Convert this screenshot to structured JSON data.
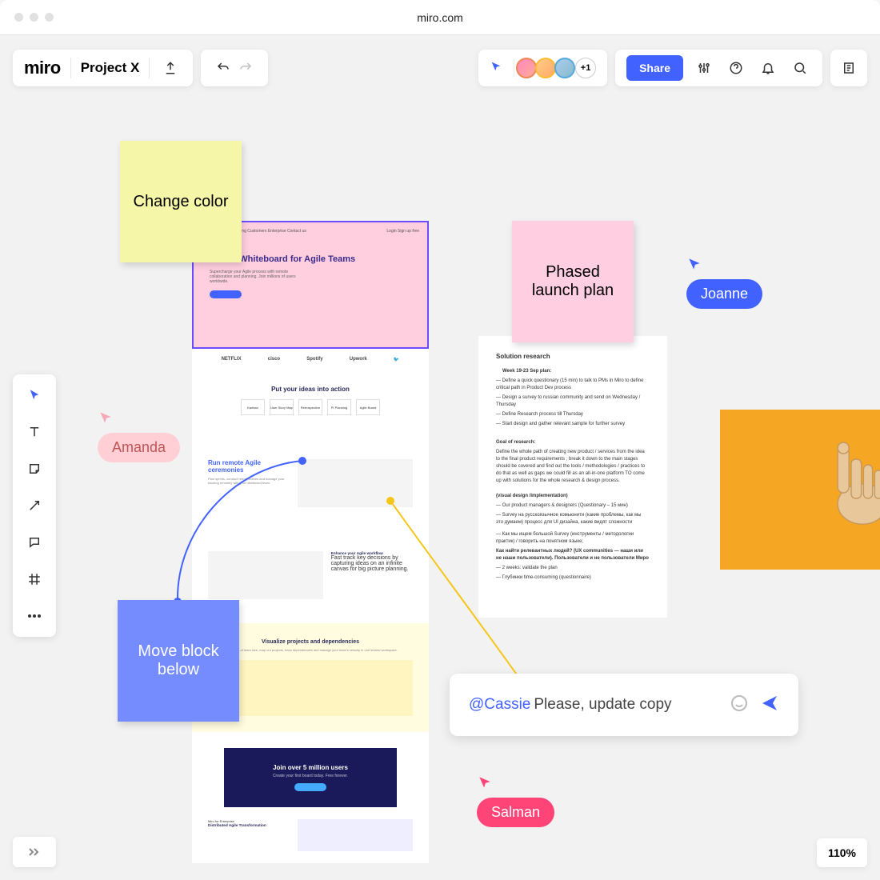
{
  "url": "miro.com",
  "header": {
    "logo": "miro",
    "project_name": "Project X",
    "more_avatars": "+1",
    "share_label": "Share"
  },
  "stickies": {
    "yellow": "Change color",
    "pink": "Phased launch plan",
    "blue": "Move block below"
  },
  "cursors": {
    "amanda": "Amanda",
    "joanne": "Joanne",
    "salman": "Salman"
  },
  "mockup": {
    "nav": "Product   Solutions   Pricing   Customers   Enterprise   Contact us",
    "nav_right": "Login   Sign up free",
    "hero_title": "Online Whiteboard for Agile Teams",
    "hero_sub": "Supercharge your Agile process with remote collaboration and planning. Join millions of users worldwide.",
    "logos": {
      "l1": "NETFLIX",
      "l2": "cisco",
      "l3": "Spotify",
      "l4": "Upwork",
      "l5": ""
    },
    "ideas_title": "Put your ideas into action",
    "cards": {
      "c1": "Kanban",
      "c2": "User Story Map",
      "c3": "Retrospective",
      "c4": "PI Planning",
      "c5": "Agile Board"
    },
    "remote_title": "Run remote Agile ceremonies",
    "remote_sub": "Plan sprints, conduct retrospectives and manage your backlog remotely with your distributed team.",
    "enhance_title": "Enhance your Agile workflow",
    "enhance_sub": "Fast track key decisions by capturing ideas on an infinite canvas for big picture planning.",
    "visualize_title": "Visualize projects and dependencies",
    "visualize_sub": "Regardless of team size, map out projects, track dependencies and manage your team's velocity in one shared workspace.",
    "join_title": "Join over 5 million users",
    "join_sub": "Create your first board today. Free forever.",
    "dist_title": "Distributed Agile Transformation",
    "dist_kicker": "Miro for Enterprise"
  },
  "document": {
    "title": "Solution research",
    "plan_title": "Week 19-23 Sep plan:",
    "p1": "— Define a quick questionary (15 min) to talk to PMs in Miro to define critical path in Product Dev process",
    "p2": "— Design a survey to russian community and send on Wednesday / Thursday",
    "p3": "— Define Research process till Thursday",
    "p4": "— Start design and gather relevant sample for further survey",
    "goal_title": "Goal of research:",
    "goal": "Define the whole path of creating new product / services from the idea to the final product requirements ; break it down to the main stages should be covered and find out the tools / methodologies / practices to do that as well as gaps we could fill as an all-in-one platform TO come up with solutions for the whole research & design process.",
    "visual": "(visual design /implementation)",
    "q1": "— Our product managers & designers (Questionary – 15 мин)",
    "q2": "— Survey на русскоязычное комьюнити (какие проблемы, как мы это думаем) процесс для UI дизайна, какие видят сложности",
    "q3": "— Как мы ищем большой Survey (инструменты / методологии практик) / говорить на понятном языке;",
    "q4": "Как найти релевантных людей? (UX communities — наши или не наши пользователи). Пользователи и не пользователи Миро",
    "q5": "— 2 weeks: validate the plan",
    "q6": "— Глубинки time-consuming (questionnaire)"
  },
  "comment": {
    "mention": "@Cassie",
    "text": " Please, update copy"
  },
  "zoom": "110%"
}
